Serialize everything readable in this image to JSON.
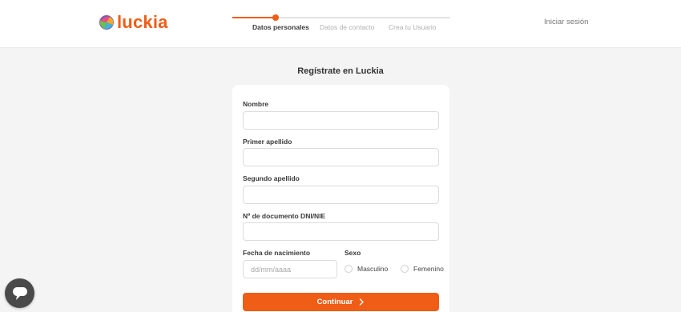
{
  "header": {
    "logo_text": "luckia",
    "login_label": "Iniciar sesión",
    "steps": [
      {
        "label": "Datos personales",
        "active": true
      },
      {
        "label": "Datos de contacto",
        "active": false
      },
      {
        "label": "Crea tu Usuario",
        "active": false
      }
    ],
    "progress_fraction": 0.2
  },
  "main": {
    "title": "Regístrate en Luckia",
    "form": {
      "nombre_label": "Nombre",
      "nombre_value": "",
      "primer_apellido_label": "Primer apellido",
      "primer_apellido_value": "",
      "segundo_apellido_label": "Segundo apellido",
      "segundo_apellido_value": "",
      "documento_label": "Nº de documento DNI/NIE",
      "documento_value": "",
      "fecha_label": "Fecha de nacimiento",
      "fecha_placeholder": "dd/mm/aaaa",
      "sexo_label": "Sexo",
      "sexo_options": [
        "Masculino",
        "Femenino"
      ],
      "submit_label": "Continuar"
    }
  },
  "colors": {
    "accent": "#ef5d16",
    "background": "#f4f4f4",
    "chat_button": "#4a4a4a"
  },
  "icons": {
    "logo": "luckia-logo-icon",
    "submit": "chevron-right-icon",
    "chat": "chat-bubble-icon"
  }
}
